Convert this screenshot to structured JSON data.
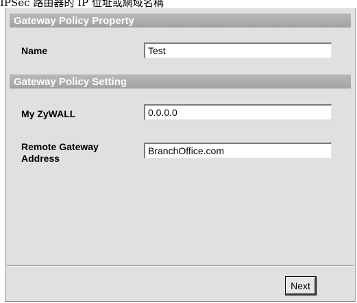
{
  "caption": "IPSec 路由器的 IP 位址或網域名稱",
  "gateway_policy_property": {
    "title": "Gateway Policy Property",
    "name_label": "Name",
    "name_value": "Test"
  },
  "gateway_policy_setting": {
    "title": "Gateway Policy Setting",
    "my_zywall_label": "My ZyWALL",
    "my_zywall_value": "0.0.0.0",
    "remote_gateway_label_line1": "Remote Gateway",
    "remote_gateway_label_line2": "Address",
    "remote_gateway_value": "BranchOffice.com"
  },
  "buttons": {
    "next_label": "Next"
  },
  "colors": {
    "section_bar": "#a8a8a8",
    "panel_background": "#e0e0e0"
  }
}
